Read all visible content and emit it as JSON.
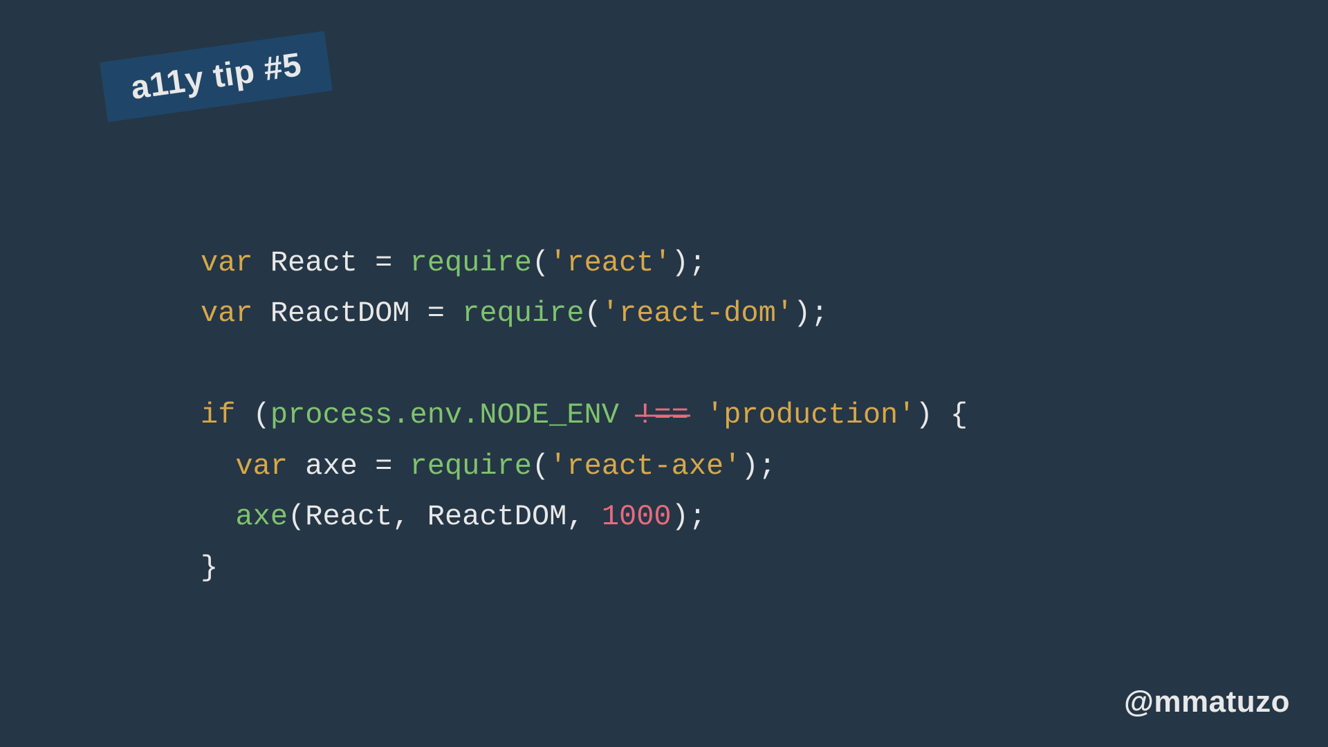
{
  "badge": {
    "label": "a11y tip #5"
  },
  "code": {
    "l1_kw": "var",
    "l1_id": "React",
    "l1_eq": "=",
    "l1_fn": "require",
    "l1_po": "(",
    "l1_str": "'react'",
    "l1_pc": ")",
    "l1_sc": ";",
    "l2_kw": "var",
    "l2_id": "ReactDOM",
    "l2_eq": "=",
    "l2_fn": "require",
    "l2_po": "(",
    "l2_str": "'react-dom'",
    "l2_pc": ")",
    "l2_sc": ";",
    "l4_kw": "if",
    "l4_po": "(",
    "l4_expr": "process.env.NODE_ENV",
    "l4_ne": "!==",
    "l4_str": "'production'",
    "l4_pc": ")",
    "l4_brace": "{",
    "l5_indent": "  ",
    "l5_kw": "var",
    "l5_id": "axe",
    "l5_eq": "=",
    "l5_fn": "require",
    "l5_po": "(",
    "l5_str": "'react-axe'",
    "l5_pc": ")",
    "l5_sc": ";",
    "l6_indent": "  ",
    "l6_fn": "axe",
    "l6_po": "(",
    "l6_a1": "React",
    "l6_c1": ",",
    "l6_a2": "ReactDOM",
    "l6_c2": ",",
    "l6_num": "1000",
    "l6_pc": ")",
    "l6_sc": ";",
    "l7_brace": "}"
  },
  "footer": {
    "handle": "@mmatuzo"
  },
  "colors": {
    "background": "#253646",
    "badge_bg": "#1f4668",
    "text": "#e8e8e8",
    "keyword": "#d7a84a",
    "function": "#7fc36e",
    "string": "#d7a84a",
    "number": "#e86b7c"
  }
}
